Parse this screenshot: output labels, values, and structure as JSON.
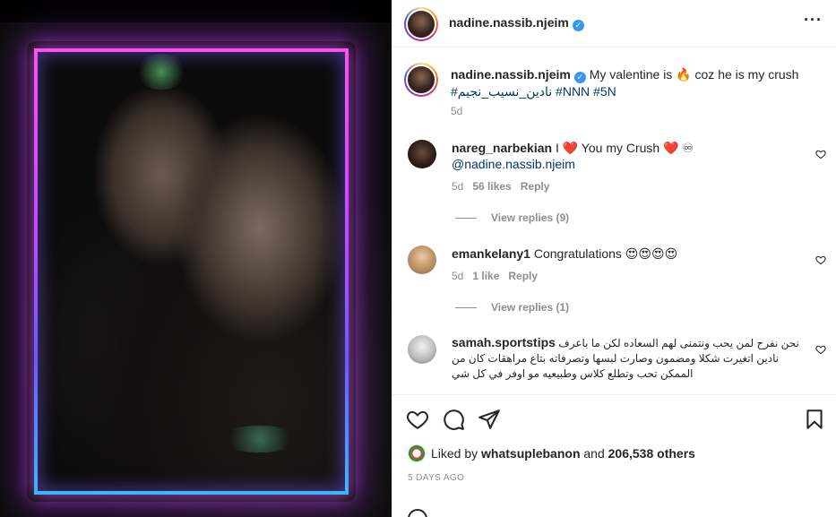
{
  "post": {
    "author": "nadine.nassib.njeim",
    "caption_text": "My valentine is 🔥 coz he is my crush",
    "caption_hashtags": "#نادين_نسيب_نجيم #NNN #5N",
    "caption_time": "5d"
  },
  "comments": [
    {
      "username": "nareg_narbekian",
      "text": "I ❤️ You my Crush ❤️ ♾",
      "mention": "@nadine.nassib.njeim",
      "time": "5d",
      "likes": "56 likes",
      "reply": "Reply",
      "view_replies": "View replies (9)"
    },
    {
      "username": "emankelany1",
      "text": "Congratulations 😍😍😍😍",
      "time": "5d",
      "likes": "1 like",
      "reply": "Reply",
      "view_replies": "View replies (1)"
    },
    {
      "username": "samah.sportstips",
      "text": "نحن نفرح لمن يحب ونتمنى لهم السعاده لكن ما باعرف نادين اتغيرت شكلا ومضمون وصارت لبسها وتصرفاته بتاع مراهقات كان من الممكن تحب وتطلع كلاس وطبيعيه مو اوفر في كل شي"
    }
  ],
  "likes": {
    "prefix": "Liked by",
    "user": "whatsuplebanon",
    "and": "and",
    "count": "206,538 others"
  },
  "date": "5 DAYS AGO",
  "icons": {
    "more": "more-options-icon",
    "like": "heart-icon",
    "comment": "comment-icon",
    "share": "share-icon",
    "save": "bookmark-icon",
    "verified": "verified-badge-icon"
  },
  "colors": {
    "link": "#00376b",
    "verified": "#3897f0",
    "muted": "#8e8e8e",
    "text": "#262626"
  }
}
